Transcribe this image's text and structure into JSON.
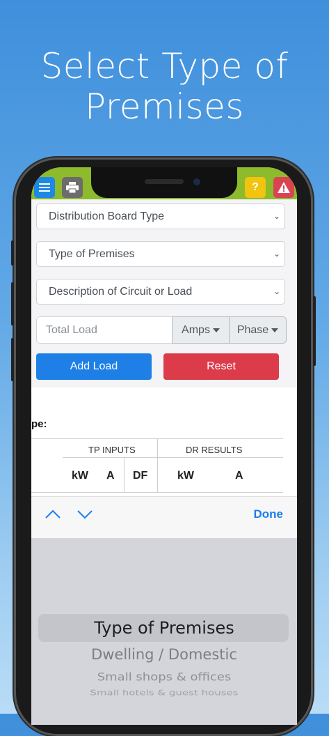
{
  "headline": {
    "line1": "Select Type of",
    "line2": "Premises"
  },
  "topbar": {
    "menu_icon": "hamburger-menu-icon",
    "print_icon": "printer-icon",
    "help_label": "?",
    "warn_label": "!"
  },
  "form": {
    "distribution_board": "Distribution Board Type",
    "type_of_premises": "Type of Premises",
    "description": "Description of Circuit or Load",
    "total_load_placeholder": "Total Load",
    "amps_label": "Amps",
    "phase_label": "Phase",
    "add_load_label": "Add Load",
    "reset_label": "Reset"
  },
  "table": {
    "type_label": "pe:",
    "group_tp": "TP INPUTS",
    "group_dr": "DR RESULTS",
    "cols": [
      "kW",
      "A",
      "DF",
      "kW",
      "A"
    ]
  },
  "accessory": {
    "done_label": "Done"
  },
  "picker": {
    "items": [
      "Type of Premises",
      "Dwelling / Domestic",
      "Small shops & offices",
      "Small hotels & guest houses"
    ],
    "selected_index": 0
  },
  "colors": {
    "topbar": "#8dbb2c",
    "primary": "#1e7fe6",
    "danger": "#dc3c4a",
    "warning": "#f1c40f",
    "ios_blue": "#1a7ef0"
  }
}
